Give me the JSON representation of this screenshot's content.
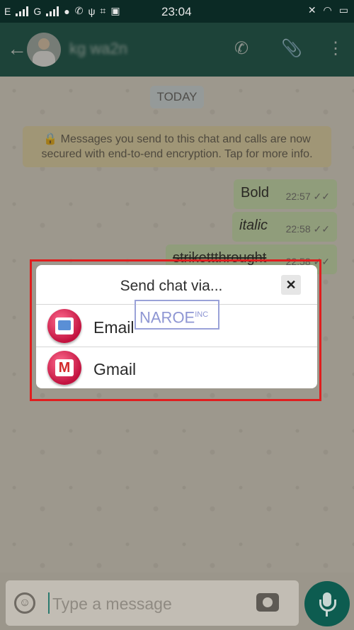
{
  "status_bar": {
    "carrier1": "E",
    "carrier2": "G",
    "time": "23:04"
  },
  "header": {
    "back_icon": "arrow-back-icon",
    "contact_name": "kg wa2n",
    "call_icon": "phone-icon",
    "attach_icon": "paperclip-icon",
    "menu_icon": "more-vert-icon"
  },
  "chat": {
    "date_chip": "TODAY",
    "encryption_notice": "🔒 Messages you send to this chat and calls are now secured with end-to-end encryption. Tap for more info.",
    "messages": [
      {
        "text": "Bold",
        "time": "22:57",
        "status": "✓✓"
      },
      {
        "text": "italic",
        "time": "22:58",
        "status": "✓✓"
      },
      {
        "text": "strikettthrought",
        "time": "22:58",
        "status": "✓✓"
      }
    ]
  },
  "dialog": {
    "title": "Send chat via...",
    "close_label": "✕",
    "options": [
      {
        "label": "Email",
        "icon": "email-app-icon"
      },
      {
        "label": "Gmail",
        "icon": "gmail-icon"
      }
    ]
  },
  "watermark": {
    "text": "NAROE",
    "suffix": "INC"
  },
  "input": {
    "placeholder": "Type a message"
  },
  "colors": {
    "header": "#0b4b42",
    "outgoing_bubble": "#c4dcab",
    "highlight_box": "#e01e1e",
    "mic_button": "#0d5c50"
  }
}
